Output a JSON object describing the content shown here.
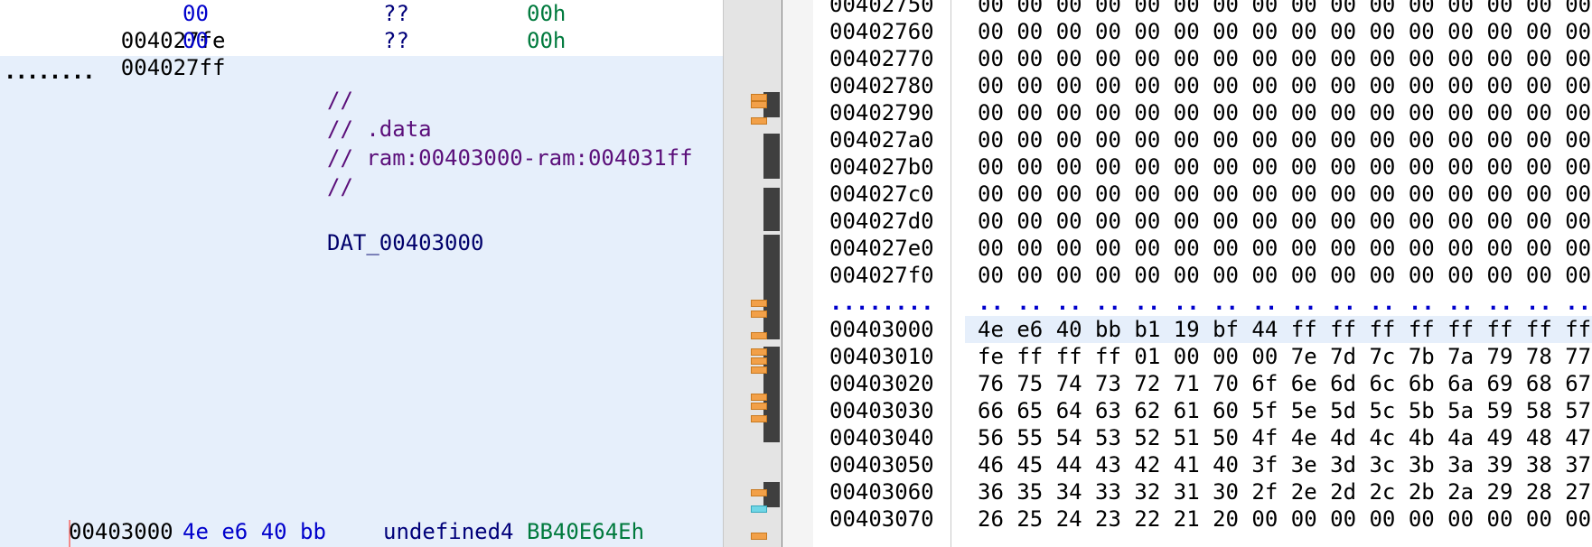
{
  "listing": {
    "rows_top": [
      {
        "address": "004027fe",
        "bytes": "00",
        "mnemonic": "??",
        "operand": "00h"
      },
      {
        "address": "004027ff",
        "bytes": "00",
        "mnemonic": "??",
        "operand": "00h"
      }
    ],
    "separator": "........",
    "comments": [
      "//",
      "// .data",
      "// ram:00403000-ram:004031ff",
      "//"
    ],
    "label": "DAT_00403000",
    "row_bottom": {
      "address": "00403000",
      "bytes": "4e e6 40 bb",
      "mnemonic": "undefined4",
      "operand": "BB40E64Eh"
    }
  },
  "hex": {
    "rows_before": [
      {
        "address": "00402750",
        "bytes": "00 00 00 00 00 00 00 00 00 00 00 00 00 00 00 00"
      },
      {
        "address": "00402760",
        "bytes": "00 00 00 00 00 00 00 00 00 00 00 00 00 00 00 00"
      },
      {
        "address": "00402770",
        "bytes": "00 00 00 00 00 00 00 00 00 00 00 00 00 00 00 00"
      },
      {
        "address": "00402780",
        "bytes": "00 00 00 00 00 00 00 00 00 00 00 00 00 00 00 00"
      },
      {
        "address": "00402790",
        "bytes": "00 00 00 00 00 00 00 00 00 00 00 00 00 00 00 00"
      },
      {
        "address": "004027a0",
        "bytes": "00 00 00 00 00 00 00 00 00 00 00 00 00 00 00 00"
      },
      {
        "address": "004027b0",
        "bytes": "00 00 00 00 00 00 00 00 00 00 00 00 00 00 00 00"
      },
      {
        "address": "004027c0",
        "bytes": "00 00 00 00 00 00 00 00 00 00 00 00 00 00 00 00"
      },
      {
        "address": "004027d0",
        "bytes": "00 00 00 00 00 00 00 00 00 00 00 00 00 00 00 00"
      },
      {
        "address": "004027e0",
        "bytes": "00 00 00 00 00 00 00 00 00 00 00 00 00 00 00 00"
      },
      {
        "address": "004027f0",
        "bytes": "00 00 00 00 00 00 00 00 00 00 00 00 00 00 00 00"
      }
    ],
    "separator_addr": "........",
    "separator_bytes": ".. .. .. .. .. .. .. .. .. .. .. .. .. .. .. ..",
    "rows_after": [
      {
        "address": "00403000",
        "bytes": "4e e6 40 bb b1 19 bf 44 ff ff ff ff ff ff ff ff"
      },
      {
        "address": "00403010",
        "bytes": "fe ff ff ff 01 00 00 00 7e 7d 7c 7b 7a 79 78 77"
      },
      {
        "address": "00403020",
        "bytes": "76 75 74 73 72 71 70 6f 6e 6d 6c 6b 6a 69 68 67"
      },
      {
        "address": "00403030",
        "bytes": "66 65 64 63 62 61 60 5f 5e 5d 5c 5b 5a 59 58 57"
      },
      {
        "address": "00403040",
        "bytes": "56 55 54 53 52 51 50 4f 4e 4d 4c 4b 4a 49 48 47"
      },
      {
        "address": "00403050",
        "bytes": "46 45 44 43 42 41 40 3f 3e 3d 3c 3b 3a 39 38 37"
      },
      {
        "address": "00403060",
        "bytes": "36 35 34 33 32 31 30 2f 2e 2d 2c 2b 2a 29 28 27"
      },
      {
        "address": "00403070",
        "bytes": "26 25 24 23 22 21 20 00 00 00 00 00 00 00 00 00"
      }
    ]
  },
  "colors": {
    "selection": "#e6effb",
    "bytes": "#0000cc",
    "operand": "#007a3d",
    "comment": "#5b0f7a",
    "marker": "#f2a048"
  }
}
